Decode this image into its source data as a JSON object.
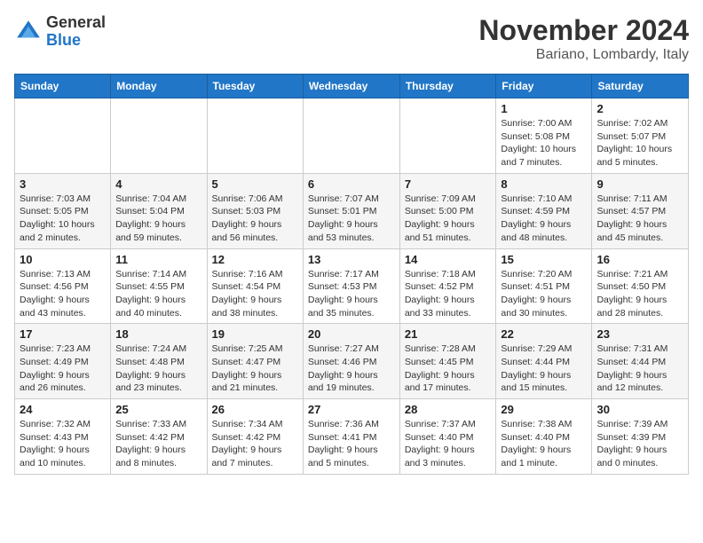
{
  "header": {
    "logo_general": "General",
    "logo_blue": "Blue",
    "month_title": "November 2024",
    "location": "Bariano, Lombardy, Italy"
  },
  "weekdays": [
    "Sunday",
    "Monday",
    "Tuesday",
    "Wednesday",
    "Thursday",
    "Friday",
    "Saturday"
  ],
  "weeks": [
    [
      {
        "day": "",
        "info": ""
      },
      {
        "day": "",
        "info": ""
      },
      {
        "day": "",
        "info": ""
      },
      {
        "day": "",
        "info": ""
      },
      {
        "day": "",
        "info": ""
      },
      {
        "day": "1",
        "info": "Sunrise: 7:00 AM\nSunset: 5:08 PM\nDaylight: 10 hours and 7 minutes."
      },
      {
        "day": "2",
        "info": "Sunrise: 7:02 AM\nSunset: 5:07 PM\nDaylight: 10 hours and 5 minutes."
      }
    ],
    [
      {
        "day": "3",
        "info": "Sunrise: 7:03 AM\nSunset: 5:05 PM\nDaylight: 10 hours and 2 minutes."
      },
      {
        "day": "4",
        "info": "Sunrise: 7:04 AM\nSunset: 5:04 PM\nDaylight: 9 hours and 59 minutes."
      },
      {
        "day": "5",
        "info": "Sunrise: 7:06 AM\nSunset: 5:03 PM\nDaylight: 9 hours and 56 minutes."
      },
      {
        "day": "6",
        "info": "Sunrise: 7:07 AM\nSunset: 5:01 PM\nDaylight: 9 hours and 53 minutes."
      },
      {
        "day": "7",
        "info": "Sunrise: 7:09 AM\nSunset: 5:00 PM\nDaylight: 9 hours and 51 minutes."
      },
      {
        "day": "8",
        "info": "Sunrise: 7:10 AM\nSunset: 4:59 PM\nDaylight: 9 hours and 48 minutes."
      },
      {
        "day": "9",
        "info": "Sunrise: 7:11 AM\nSunset: 4:57 PM\nDaylight: 9 hours and 45 minutes."
      }
    ],
    [
      {
        "day": "10",
        "info": "Sunrise: 7:13 AM\nSunset: 4:56 PM\nDaylight: 9 hours and 43 minutes."
      },
      {
        "day": "11",
        "info": "Sunrise: 7:14 AM\nSunset: 4:55 PM\nDaylight: 9 hours and 40 minutes."
      },
      {
        "day": "12",
        "info": "Sunrise: 7:16 AM\nSunset: 4:54 PM\nDaylight: 9 hours and 38 minutes."
      },
      {
        "day": "13",
        "info": "Sunrise: 7:17 AM\nSunset: 4:53 PM\nDaylight: 9 hours and 35 minutes."
      },
      {
        "day": "14",
        "info": "Sunrise: 7:18 AM\nSunset: 4:52 PM\nDaylight: 9 hours and 33 minutes."
      },
      {
        "day": "15",
        "info": "Sunrise: 7:20 AM\nSunset: 4:51 PM\nDaylight: 9 hours and 30 minutes."
      },
      {
        "day": "16",
        "info": "Sunrise: 7:21 AM\nSunset: 4:50 PM\nDaylight: 9 hours and 28 minutes."
      }
    ],
    [
      {
        "day": "17",
        "info": "Sunrise: 7:23 AM\nSunset: 4:49 PM\nDaylight: 9 hours and 26 minutes."
      },
      {
        "day": "18",
        "info": "Sunrise: 7:24 AM\nSunset: 4:48 PM\nDaylight: 9 hours and 23 minutes."
      },
      {
        "day": "19",
        "info": "Sunrise: 7:25 AM\nSunset: 4:47 PM\nDaylight: 9 hours and 21 minutes."
      },
      {
        "day": "20",
        "info": "Sunrise: 7:27 AM\nSunset: 4:46 PM\nDaylight: 9 hours and 19 minutes."
      },
      {
        "day": "21",
        "info": "Sunrise: 7:28 AM\nSunset: 4:45 PM\nDaylight: 9 hours and 17 minutes."
      },
      {
        "day": "22",
        "info": "Sunrise: 7:29 AM\nSunset: 4:44 PM\nDaylight: 9 hours and 15 minutes."
      },
      {
        "day": "23",
        "info": "Sunrise: 7:31 AM\nSunset: 4:44 PM\nDaylight: 9 hours and 12 minutes."
      }
    ],
    [
      {
        "day": "24",
        "info": "Sunrise: 7:32 AM\nSunset: 4:43 PM\nDaylight: 9 hours and 10 minutes."
      },
      {
        "day": "25",
        "info": "Sunrise: 7:33 AM\nSunset: 4:42 PM\nDaylight: 9 hours and 8 minutes."
      },
      {
        "day": "26",
        "info": "Sunrise: 7:34 AM\nSunset: 4:42 PM\nDaylight: 9 hours and 7 minutes."
      },
      {
        "day": "27",
        "info": "Sunrise: 7:36 AM\nSunset: 4:41 PM\nDaylight: 9 hours and 5 minutes."
      },
      {
        "day": "28",
        "info": "Sunrise: 7:37 AM\nSunset: 4:40 PM\nDaylight: 9 hours and 3 minutes."
      },
      {
        "day": "29",
        "info": "Sunrise: 7:38 AM\nSunset: 4:40 PM\nDaylight: 9 hours and 1 minute."
      },
      {
        "day": "30",
        "info": "Sunrise: 7:39 AM\nSunset: 4:39 PM\nDaylight: 9 hours and 0 minutes."
      }
    ]
  ]
}
